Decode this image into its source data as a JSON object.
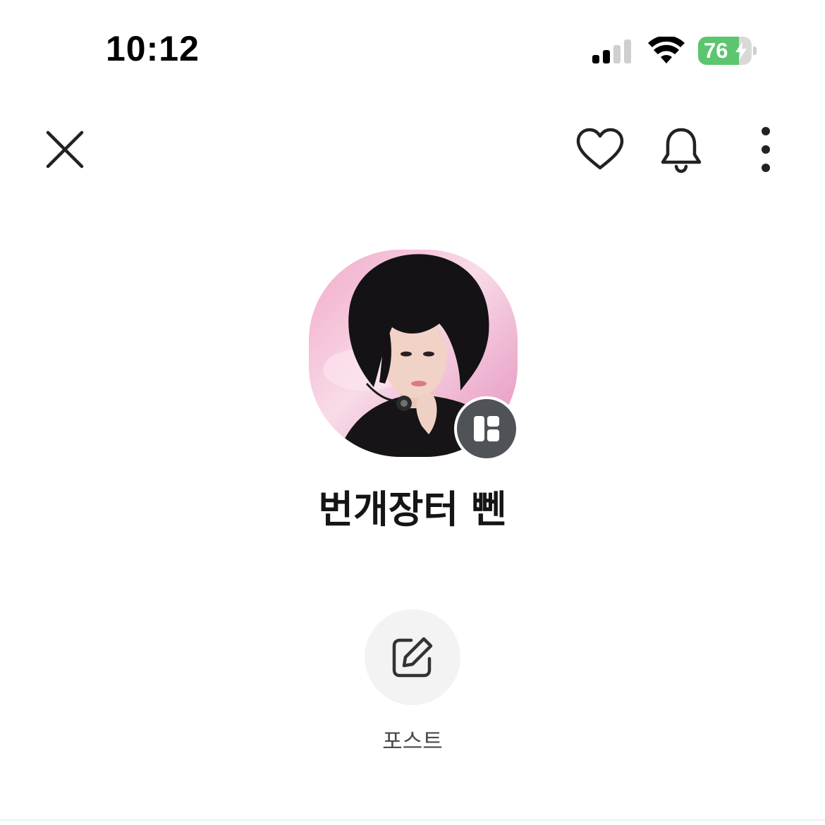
{
  "status_bar": {
    "time": "10:12",
    "battery_level": "76",
    "battery_fraction": 0.76,
    "cellular_bars_active": 2,
    "cellular_bars_total": 4,
    "battery_color": "#5cc56f",
    "icons": [
      "cellular-signal-icon",
      "wifi-icon",
      "battery-icon",
      "charging-bolt-icon"
    ]
  },
  "top_nav": {
    "icons": [
      "close-icon",
      "heart-icon",
      "bell-icon",
      "more-vertical-icon"
    ]
  },
  "profile": {
    "name": "번개장터 뻰",
    "badge_icon": "store-icon",
    "badge_color": "#4f5358"
  },
  "actions": {
    "post_label": "포스트",
    "post_icon": "edit-icon"
  }
}
